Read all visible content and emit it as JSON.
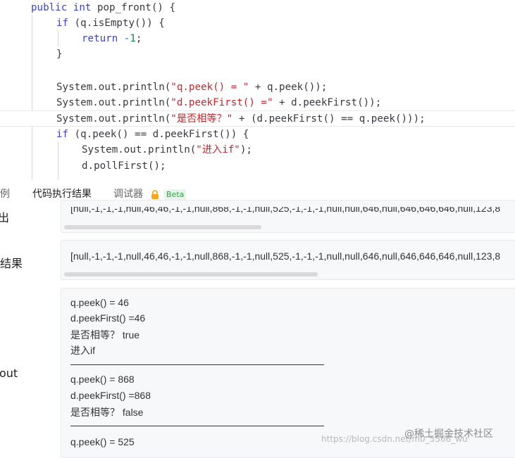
{
  "editor": {
    "lines": [
      {
        "id": "l1",
        "segs": [
          [
            "kw",
            "public "
          ],
          [
            "kw",
            "int "
          ],
          [
            "",
            "pop_front() {"
          ]
        ]
      },
      {
        "id": "l2",
        "segs": [
          [
            "kw",
            "if "
          ],
          [
            "",
            "(q.isEmpty()) {"
          ]
        ]
      },
      {
        "id": "l3",
        "segs": [
          [
            "kw",
            "return "
          ],
          [
            "num",
            "-1"
          ],
          [
            "",
            ";"
          ]
        ]
      },
      {
        "id": "l4",
        "segs": [
          [
            "",
            "}"
          ]
        ]
      },
      {
        "id": "l5",
        "segs": [
          [
            "",
            ""
          ]
        ]
      },
      {
        "id": "l6",
        "segs": [
          [
            "",
            "System.out.println("
          ],
          [
            "str",
            "\"q.peek() = \""
          ],
          [
            "",
            " + q.peek());"
          ]
        ]
      },
      {
        "id": "l7",
        "segs": [
          [
            "",
            "System.out.println("
          ],
          [
            "str",
            "\"d.peekFirst() =\""
          ],
          [
            "",
            " + d.peekFirst());"
          ]
        ]
      },
      {
        "id": "l8",
        "segs": [
          [
            "",
            "System.out.println("
          ],
          [
            "str",
            "\"是否相等？\""
          ],
          [
            "",
            " + (d.peekFirst() == q.peek()));"
          ]
        ]
      },
      {
        "id": "l9",
        "segs": [
          [
            "kw",
            "if "
          ],
          [
            "",
            "(q.peek() == d.peekFirst()) {"
          ]
        ]
      },
      {
        "id": "l10",
        "segs": [
          [
            "",
            "System.out.println("
          ],
          [
            "str",
            "\"进入if\""
          ],
          [
            "",
            ");"
          ]
        ]
      },
      {
        "id": "l11",
        "segs": [
          [
            "",
            "d.pollFirst();"
          ]
        ]
      }
    ]
  },
  "tabs": [
    {
      "label": "用例"
    },
    {
      "label": "代码执行结果"
    },
    {
      "label": "调试器"
    }
  ],
  "beta_label": "Beta",
  "side_labels": {
    "output": "出",
    "expected": "期结果",
    "stdout": "out"
  },
  "output_text": "[null,-1,-1,-1,null,46,46,-1,-1,null,868,-1,-1,null,525,-1,-1,-1,null,null,646,null,646,646,646,null,123,8",
  "expected_text": "[null,-1,-1,-1,null,46,46,-1,-1,null,868,-1,-1,null,525,-1,-1,-1,null,null,646,null,646,646,646,null,123,8",
  "stdout": {
    "lines": [
      "q.peek() = 46",
      "d.peekFirst() =46",
      "是否相等？ true",
      "进入if",
      "q.peek() = 868",
      "d.peekFirst() =868",
      "是否相等？ false",
      "q.peek() = 525"
    ]
  },
  "watermark_url": "https://blog.csdn.net/m0_5566_wu",
  "watermark_brand": "@稀土掘金技术社区"
}
